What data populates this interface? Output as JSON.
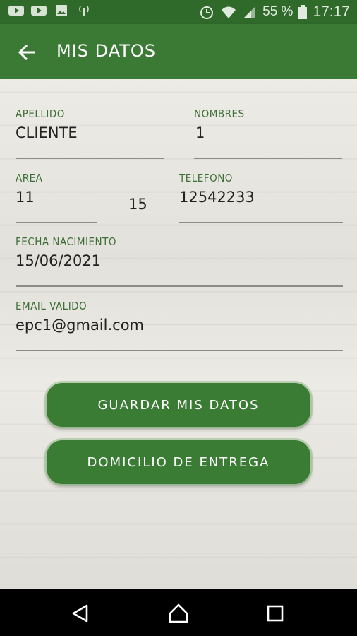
{
  "status_bar": {
    "battery": "55 %",
    "time": "17:17",
    "icons": [
      "youtube-icon",
      "youtube-icon",
      "image-icon",
      "signal-tower-icon",
      "alarm-icon",
      "wifi-icon",
      "cell-signal-icon",
      "battery-icon"
    ]
  },
  "app_bar": {
    "title": "MIS DATOS",
    "back_icon": "arrow-left-icon"
  },
  "form": {
    "apellido": {
      "label": "APELLIDO",
      "value": "CLIENTE"
    },
    "nombres": {
      "label": "NOMBRES",
      "value": "1"
    },
    "area": {
      "label": "AREA",
      "value": "11",
      "prefix": "15"
    },
    "telefono": {
      "label": "TELEFONO",
      "value": "12542233"
    },
    "fecha": {
      "label": "FECHA NACIMIENTO",
      "value": "15/06/2021"
    },
    "email": {
      "label": "EMAIL VALIDO",
      "value": "epc1@gmail.com"
    }
  },
  "buttons": {
    "save_label": "GUARDAR MIS DATOS",
    "delivery_label": "DOMICILIO DE ENTREGA"
  },
  "colors": {
    "status_bar": "#2f6a2a",
    "app_bar": "#3a7a34",
    "label": "#3f6f39",
    "button": "#3b7c34"
  },
  "nav_bar": {
    "icons": [
      "back-triangle-icon",
      "home-circle-icon",
      "recents-square-icon"
    ]
  }
}
